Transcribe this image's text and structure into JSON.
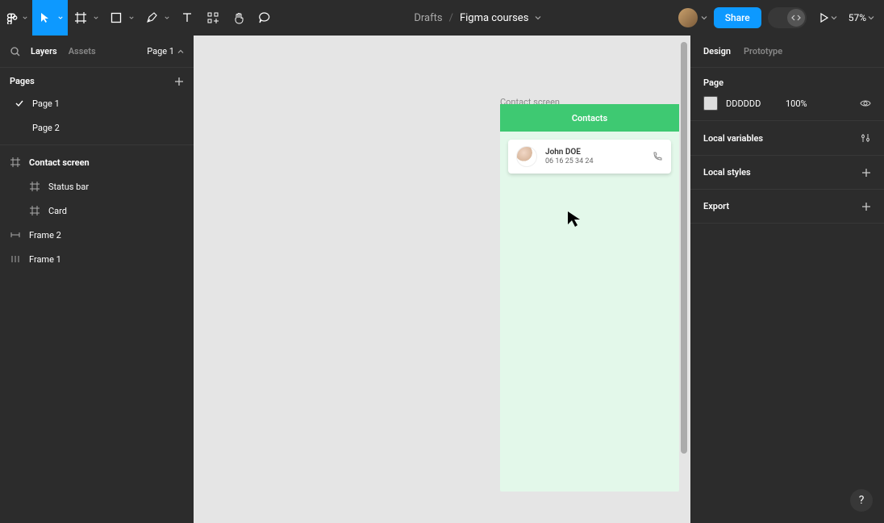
{
  "toolbar": {
    "breadcrumb_parent": "Drafts",
    "breadcrumb_separator": "/",
    "file_name": "Figma courses",
    "share_label": "Share",
    "zoom_label": "57%"
  },
  "left_panel": {
    "tabs": {
      "layers": "Layers",
      "assets": "Assets"
    },
    "page_selector": "Page 1",
    "pages_header": "Pages",
    "pages": {
      "page1": "Page 1",
      "page2": "Page 2"
    },
    "layers": {
      "contact_screen": "Contact screen",
      "status_bar": "Status bar",
      "card": "Card",
      "frame2": "Frame 2",
      "frame1": "Frame 1"
    }
  },
  "right_panel": {
    "tabs": {
      "design": "Design",
      "prototype": "Prototype"
    },
    "page_section_title": "Page",
    "page_color_hex": "DDDDDD",
    "page_color_opacity": "100%",
    "local_variables": "Local variables",
    "local_styles": "Local styles",
    "export": "Export"
  },
  "canvas": {
    "frame_label": "Contact screen",
    "status_bar_title": "Contacts",
    "card_name": "John DOE",
    "card_phone": "06 16 25 34 24"
  },
  "help_label": "?"
}
